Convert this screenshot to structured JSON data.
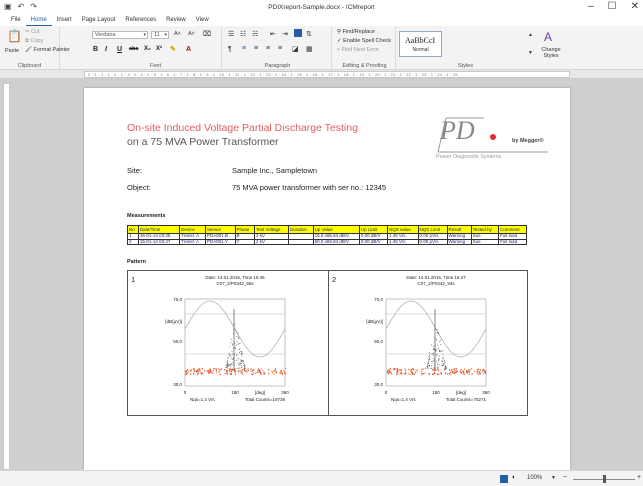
{
  "window": {
    "title": "PDIXreport-Sample.docx - ICMreport",
    "minimize": "–",
    "maximize": "☐",
    "close": "✕"
  },
  "ribbon_tabs": [
    "File",
    "Home",
    "Insert",
    "Page Layout",
    "References",
    "Review",
    "View"
  ],
  "ribbon": {
    "clipboard": {
      "paste": "Paste",
      "cut": "Cut",
      "copy": "Copy",
      "format_painter": "Format Painter",
      "label": "Clipboard"
    },
    "font": {
      "font_name": "Verdana",
      "font_size": "11",
      "bold": "B",
      "italic": "I",
      "underline": "U",
      "strike": "abc",
      "sub": "X₂",
      "sup": "X²",
      "grow": "A˄",
      "shrink": "A˅",
      "label": "Font"
    },
    "paragraph": {
      "label": "Paragraph"
    },
    "editing": {
      "find_replace": "Find/Replace",
      "spell_check": "Enable Spell Check",
      "next_error": "Find Next Error",
      "label": "Editing & Proofing"
    },
    "styles": {
      "sample": "AaBbCcI",
      "name": "Normal",
      "change": "Change Styles",
      "label": "Styles"
    }
  },
  "ruler_text": "· 2 · 1 · 1 · 1 · 2 · 1 · 3 · 1 · 4 · 1 · 5 · 1 · 6 · 1 · 7 · 1 · 8 · 1 · 9 · 1 · 10 · 1 · 11 · 1 · 12 · 1 · 13 · 1 · 14 · 1 · 15 · 1 · 16 · 1 · 17 · 1 · 18 · 1 · 19 · 1 · 20 · 1 · 21 · 1 · 22 · 1 · 23 · 1 · 24 · 1 · 25",
  "report": {
    "title_line1": "On-site Induced Voltage Partial Discharge Testing",
    "title_line2": "on a 75 MVA Power Transformer",
    "logo": {
      "mark": "PD",
      "by": "by Megger®",
      "subtitle": "Power Diagnostix Systems"
    },
    "site_label": "Site:",
    "site_value": "Sample Inc., Sampletown",
    "object_label": "Object:",
    "object_value": "75 MVA power transformer with ser no.: 12345",
    "measurements_heading": "Measurements",
    "table_headers": [
      "No",
      "Date/Time",
      "Device",
      "Sensor",
      "Phase",
      "Test Voltage",
      "Duration",
      "Up Value",
      "Up Limit",
      "NQS value",
      "NQS Limit",
      "Result",
      "Tested by",
      "Comment"
    ],
    "table_rows": [
      [
        "1",
        "15-01-14 03:45",
        "Transf. A",
        "PDA001.B",
        "B",
        "2 kV",
        "",
        "15.0 x",
        "65.64 dB/V",
        "0.00 dB/V",
        "1.45 V/s",
        "0.00 pV/s",
        "Warning",
        "Sue",
        "Full load"
      ],
      [
        "2",
        "15-01-14 03:47",
        "Transf. A",
        "PDA001.Y",
        "Y",
        "2 kV",
        "",
        "60.0 x",
        "69.84 dB/V",
        "0.00 dB/V",
        "1.45 V/s",
        "0.00 pV/s",
        "Warning",
        "Sue",
        "Full load"
      ]
    ],
    "pattern_heading": "Pattern",
    "panels": [
      {
        "number": "1",
        "date": "Date: 14.01.2015, Time 15:45",
        "file": "C07_2/P0342_55s",
        "y_top": "70,0",
        "y_unit": "[dB(µV)]",
        "y_mid": "50,0",
        "y_bottom": "30,0",
        "x_0": "0",
        "x_180": "180",
        "x_deg": "[deg]",
        "x_360": "360",
        "nqs": "Nqs=1,4 V/s",
        "counts": "Total Counts=19739"
      },
      {
        "number": "2",
        "date": "Date: 14.01.2015, Time 15:47",
        "file": "C07_2/P0342_93s",
        "y_top": "70,0",
        "y_unit": "[dB(µV)]",
        "y_mid": "50,0",
        "y_bottom": "30,0",
        "x_0": "0",
        "x_180": "180",
        "x_deg": "[deg]",
        "x_360": "360",
        "nqs": "Nqs=1,4 V/s",
        "counts": "Total Counts=75271"
      }
    ]
  },
  "statusbar": {
    "zoom": "100%"
  },
  "colors": {
    "title_red": "#e06060",
    "table_header": "#ffff00",
    "accent": "#1f5fa8"
  }
}
